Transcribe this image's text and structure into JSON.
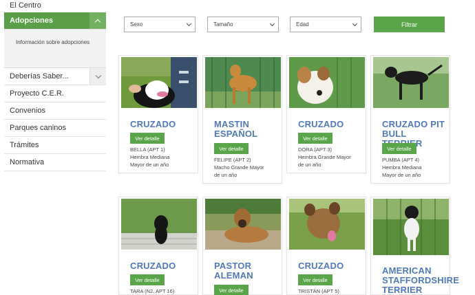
{
  "sidebar": {
    "items": [
      {
        "label": "El Centro"
      },
      {
        "label": "Adopciones"
      },
      {
        "label": "Información sobre adopciones"
      },
      {
        "label": "Deberías Saber..."
      },
      {
        "label": "Proyecto C.E.R."
      },
      {
        "label": "Convenios"
      },
      {
        "label": "Parques caninos"
      },
      {
        "label": "Trámites"
      },
      {
        "label": "Normativa"
      }
    ]
  },
  "filters": {
    "sexo": "Sexo",
    "tamano": "Tamaño",
    "edad": "Edad",
    "button": "Filtrar"
  },
  "cards": [
    {
      "title": "CRUZADO",
      "button": "Ver detalle",
      "line1": "BELLA (APT 1)",
      "line2": "Hembra Mediana",
      "line3": "Mayor de un año"
    },
    {
      "title": "MASTIN ESPAÑOL",
      "button": "Ver detalle",
      "line1": "FELIPE (APT 2)",
      "line2": "Macho Grande Mayor",
      "line3": "de un año"
    },
    {
      "title": "CRUZADO",
      "button": "Ver detalle",
      "line1": "DORA (APT 3)",
      "line2": "Hembra Grande Mayor",
      "line3": "de un año"
    },
    {
      "title": "CRUZADO PIT BULL TERRIER",
      "button": "Ver detalle",
      "line1": "PUMBA (APT 4)",
      "line2": "Hembra Mediana",
      "line3": "Mayor de un año"
    },
    {
      "title": "CRUZADO",
      "button": "Ver detalle",
      "line1": "TARA (N2, APT 16)"
    },
    {
      "title": "PASTOR ALEMAN",
      "button": "Ver detalle"
    },
    {
      "title": "CRUZADO",
      "button": "Ver detalle",
      "line1": "TRISTÁN (APT 5)"
    },
    {
      "title": "AMERICAN STAFFORDSHIRE TERRIER"
    }
  ],
  "colors": {
    "accent": "#5aa54a",
    "title": "#4f79b8"
  }
}
